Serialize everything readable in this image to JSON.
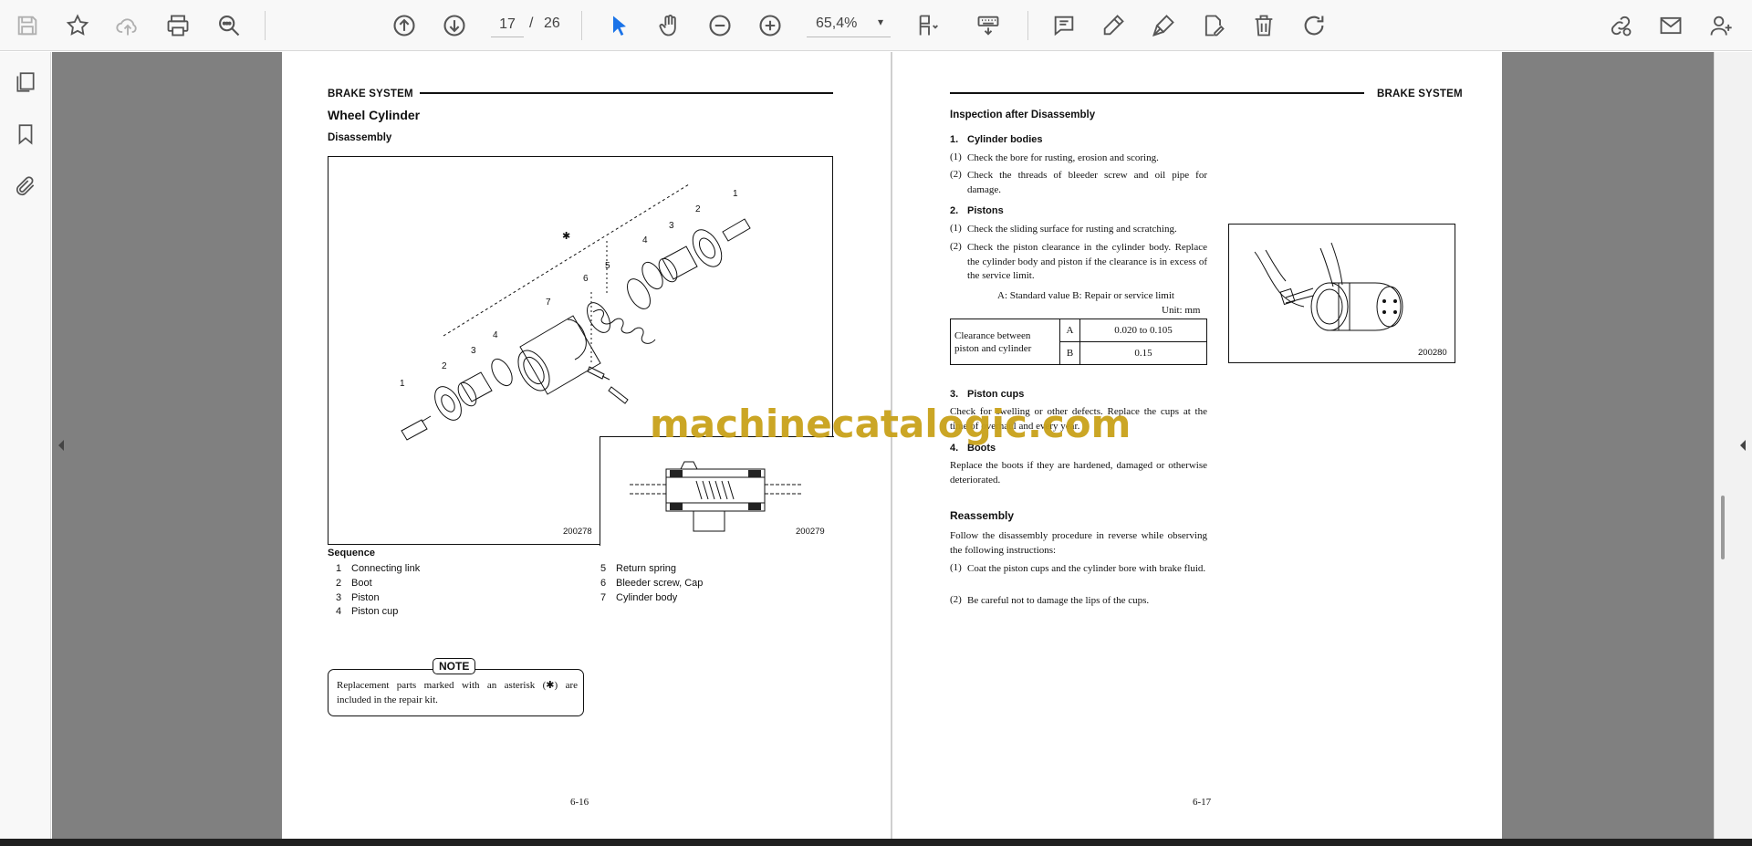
{
  "toolbar": {
    "page_current": "17",
    "page_separator": "/",
    "page_total": "26",
    "zoom": "65,4%",
    "zoom_caret": "▾",
    "icons": [
      "save-icon",
      "bookmark-star-icon",
      "upload-cloud-icon",
      "print-icon",
      "zoom-search-icon",
      "page-up-icon",
      "page-down-icon",
      "hand-pan-icon",
      "zoom-out-icon",
      "zoom-in-icon",
      "select-cursor-icon",
      "fit-page-icon",
      "keyboard-icon",
      "comment-icon",
      "highlight-pen-icon",
      "sign-pen-icon",
      "edit-doc-icon",
      "delete-trash-icon",
      "rotate-icon",
      "share-link-icon",
      "mail-icon",
      "user-add-icon"
    ]
  },
  "left_rail": {
    "icons": [
      "pages-thumbnails-icon",
      "bookmarks-icon",
      "attachments-paperclip-icon"
    ]
  },
  "doc": {
    "left": {
      "header": "BRAKE SYSTEM",
      "title": "Wheel Cylinder",
      "subtitle": "Disassembly",
      "figure_main_number": "200278",
      "figure_inset_number": "200279",
      "callouts": {
        "one_a": "1",
        "two_a": "2",
        "three_a": "3",
        "four_a": "4",
        "one_b": "1",
        "two_b": "2",
        "three_b": "3",
        "four_b": "4",
        "five": "5",
        "six": "6",
        "seven": "7",
        "asterisk": "✱"
      },
      "sequence_title": "Sequence",
      "sequence": [
        {
          "num": "1",
          "label": "Connecting link"
        },
        {
          "num": "2",
          "label": "Boot"
        },
        {
          "num": "3",
          "label": "Piston"
        },
        {
          "num": "4",
          "label": "Piston cup"
        },
        {
          "num": "5",
          "label": "Return spring"
        },
        {
          "num": "6",
          "label": "Bleeder screw, Cap"
        },
        {
          "num": "7",
          "label": "Cylinder body"
        }
      ],
      "note_tag": "NOTE",
      "note_text": "Replacement parts marked with an asterisk (✱) are included in the repair kit.",
      "page_number": "6-16"
    },
    "right": {
      "header": "BRAKE SYSTEM",
      "section1_title": "Inspection after Disassembly",
      "s1_num": "1.",
      "s1_title": "Cylinder bodies",
      "s1_items": [
        {
          "num": "(1)",
          "text": "Check the bore for rusting, erosion and scoring."
        },
        {
          "num": "(2)",
          "text": "Check the threads of bleeder screw and oil pipe for damage."
        }
      ],
      "s2_num": "2.",
      "s2_title": "Pistons",
      "s2_items": [
        {
          "num": "(1)",
          "text": "Check the sliding surface for rusting and scratching."
        },
        {
          "num": "(2)",
          "text": "Check the piston clearance in the cylinder body. Replace the cylinder body and piston if the clearance is in excess of the service limit."
        }
      ],
      "legend_text": "A:  Standard value     B:  Repair or service limit",
      "unit_text": "Unit:  mm",
      "table": {
        "label": "Clearance between piston and cylinder",
        "row_a_key": "A",
        "row_a_value": "0.020 to 0.105",
        "row_b_key": "B",
        "row_b_value": "0.15"
      },
      "figure_number": "200280",
      "s3_num": "3.",
      "s3_title": "Piston cups",
      "s3_text": "Check for swelling or other defects. Replace the cups at the time of overhaul and every year.",
      "s4_num": "4.",
      "s4_title": "Boots",
      "s4_text": "Replace the boots if they are hardened, damaged or otherwise deteriorated.",
      "section2_title": "Reassembly",
      "reassembly_intro": "Follow the disassembly procedure in reverse while observing the following instructions:",
      "reassembly_items": [
        {
          "num": "(1)",
          "text": "Coat the piston cups and the cylinder bore with brake fluid."
        },
        {
          "num": "(2)",
          "text": "Be careful not to damage the lips of the cups."
        }
      ],
      "page_number": "6-17"
    }
  },
  "watermark": "machinecatalogic.com",
  "colors": {
    "toolbar_bg": "#f8f8f8",
    "viewer_bg": "#808080",
    "accent_blue": "#1a73e8",
    "watermark": "#c9a21a"
  }
}
